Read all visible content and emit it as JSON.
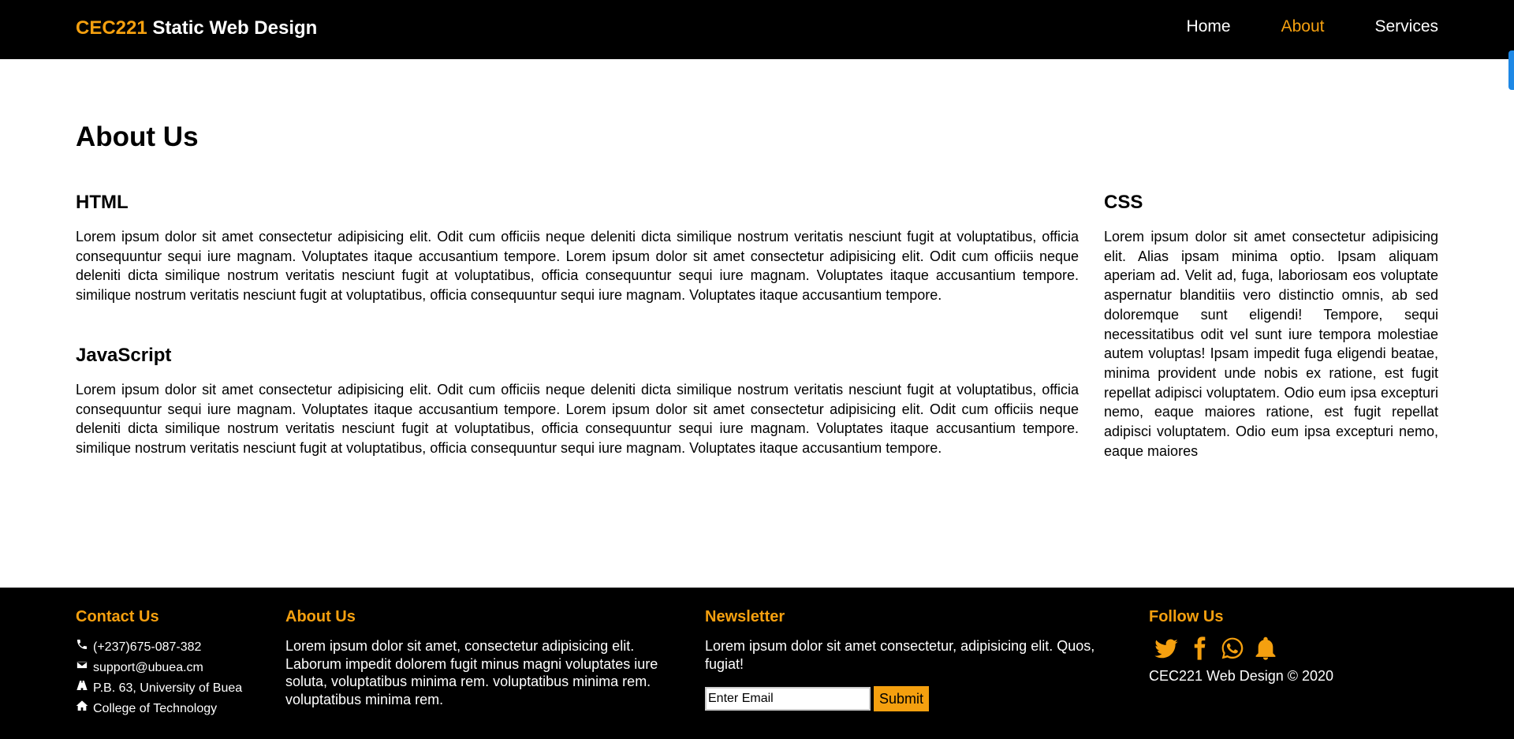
{
  "header": {
    "brand_accent": "CEC221",
    "brand_rest": " Static Web Design",
    "nav": [
      "Home",
      "About",
      "Services"
    ],
    "active_nav": "About"
  },
  "main": {
    "page_title": "About Us",
    "html": {
      "title": "HTML",
      "text": "Lorem ipsum dolor sit amet consectetur adipisicing elit. Odit cum officiis neque deleniti dicta similique nostrum veritatis nesciunt fugit at voluptatibus, officia consequuntur sequi iure magnam. Voluptates itaque accusantium tempore. Lorem ipsum dolor sit amet consectetur adipisicing elit. Odit cum officiis neque deleniti dicta similique nostrum veritatis nesciunt fugit at voluptatibus, officia consequuntur sequi iure magnam. Voluptates itaque accusantium tempore. similique nostrum veritatis nesciunt fugit at voluptatibus, officia consequuntur sequi iure magnam. Voluptates itaque accusantium tempore."
    },
    "javascript": {
      "title": "JavaScript",
      "text": "Lorem ipsum dolor sit amet consectetur adipisicing elit. Odit cum officiis neque deleniti dicta similique nostrum veritatis nesciunt fugit at voluptatibus, officia consequuntur sequi iure magnam. Voluptates itaque accusantium tempore. Lorem ipsum dolor sit amet consectetur adipisicing elit. Odit cum officiis neque deleniti dicta similique nostrum veritatis nesciunt fugit at voluptatibus, officia consequuntur sequi iure magnam. Voluptates itaque accusantium tempore. similique nostrum veritatis nesciunt fugit at voluptatibus, officia consequuntur sequi iure magnam. Voluptates itaque accusantium tempore."
    },
    "css": {
      "title": "CSS",
      "text": "Lorem ipsum dolor sit amet consectetur adipisicing elit. Alias ipsam minima optio. Ipsam aliquam aperiam ad. Velit ad, fuga, laboriosam eos voluptate aspernatur blanditiis vero distinctio omnis, ab sed doloremque sunt eligendi! Tempore, sequi necessitatibus odit vel sunt iure tempora molestiae autem voluptas! Ipsam impedit fuga eligendi beatae, minima provident unde nobis ex ratione, est fugit repellat adipisci voluptatem. Odio eum ipsa excepturi nemo, eaque maiores ratione, est fugit repellat adipisci voluptatem. Odio eum ipsa excepturi nemo, eaque maiores"
    }
  },
  "footer": {
    "contact": {
      "title": "Contact Us",
      "phone": "(+237)675-087-382",
      "email": "support@ubuea.cm",
      "address": "P.B. 63, University of Buea",
      "college": "College of Technology"
    },
    "about": {
      "title": "About Us",
      "text": "Lorem ipsum dolor sit amet, consectetur adipisicing elit. Laborum impedit dolorem fugit minus magni voluptates iure soluta, voluptatibus minima rem. voluptatibus minima rem. voluptatibus minima rem."
    },
    "newsletter": {
      "title": "Newsletter",
      "text": "Lorem ipsum dolor sit amet consectetur, adipisicing elit. Quos, fugiat!",
      "input_placeholder": "Enter Email",
      "submit_label": "Submit"
    },
    "follow": {
      "title": "Follow Us",
      "icons": [
        "twitter-icon",
        "facebook-icon",
        "whatsapp-icon",
        "bell-icon"
      ],
      "copyright": "CEC221 Web Design © 2020"
    }
  },
  "colors": {
    "accent": "#f5a00f",
    "header_bg": "#000000",
    "footer_bg": "#000000",
    "scroll_indicator": "#1e88e5"
  }
}
